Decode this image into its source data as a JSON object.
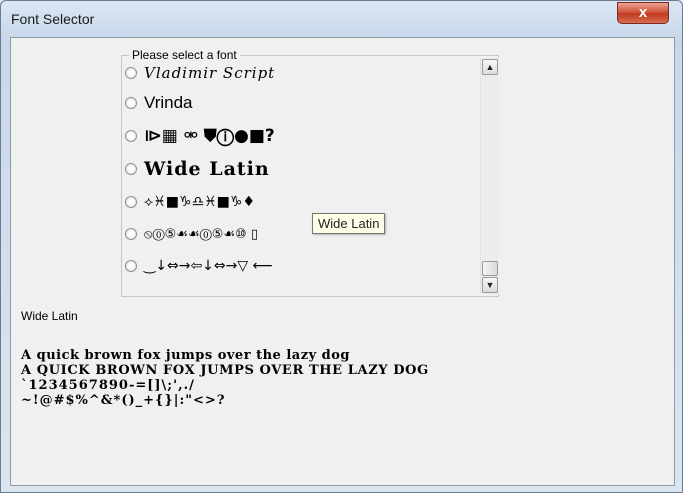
{
  "window": {
    "title": "Font Selector",
    "close_glyph": "x"
  },
  "group": {
    "legend": "Please select a font",
    "fonts": [
      {
        "label": "Vladimir Script"
      },
      {
        "label": "Vrinda"
      },
      {
        "label": "⧐▦ ⚮ ⛊ⓘ●■?"
      },
      {
        "label": "Wide Latin"
      },
      {
        "label": "⟡♓■♑♎♓■♑♦"
      },
      {
        "label": "⦸⓪⑤☙☙⓪⑤☙⑩  ▯"
      },
      {
        "label": "‿↓⇔→⇦↓⇔→▽  ⟵"
      }
    ]
  },
  "tooltip": {
    "text": "Wide Latin"
  },
  "selected_font_label": "Wide Latin",
  "sample": {
    "lower": "A quick brown fox jumps over the lazy dog",
    "upper": "A QUICK BROWN FOX JUMPS OVER THE LAZY DOG",
    "numbers": "`1234567890-=[]\\;',./",
    "symbols": "~!@#$%^&*()_+{}|:\"<>?"
  }
}
